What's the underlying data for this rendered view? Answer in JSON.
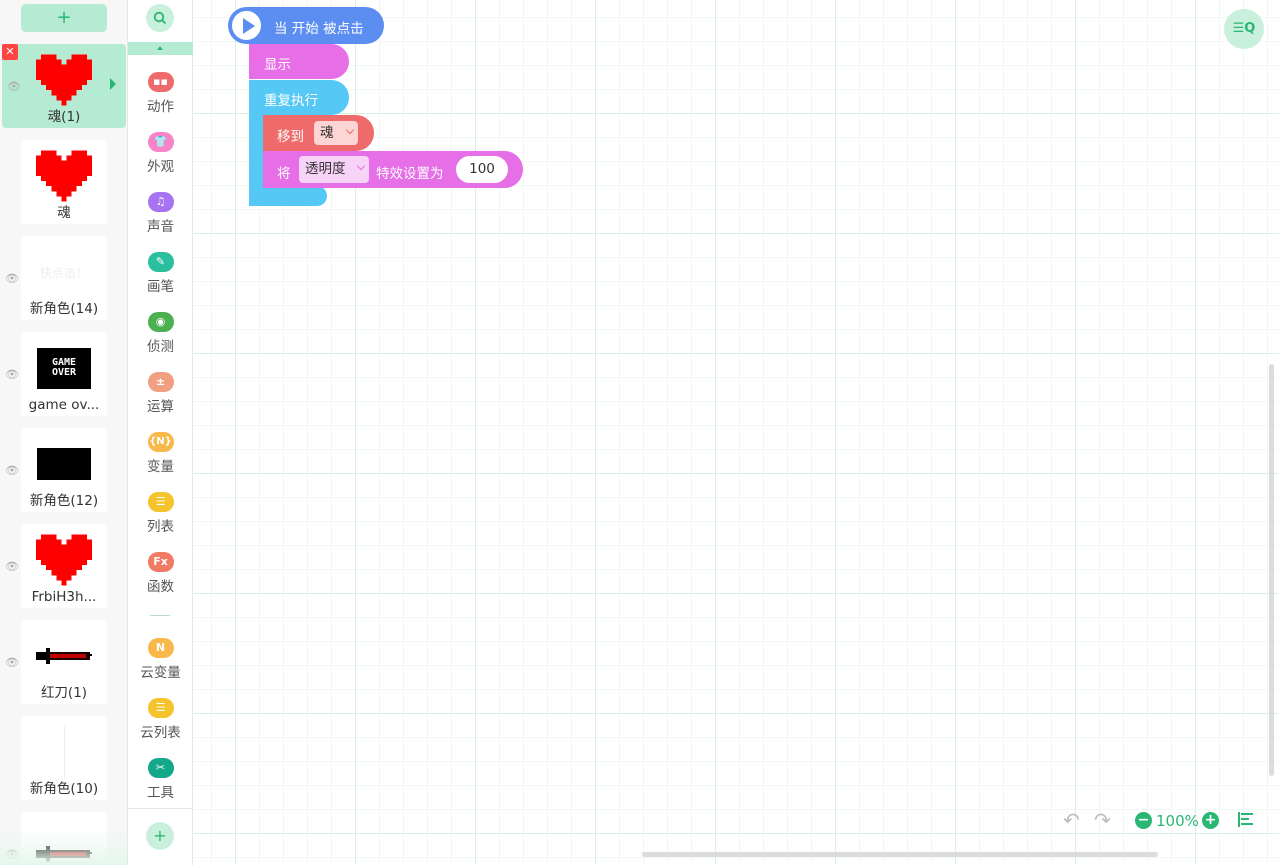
{
  "sprite_panel": {
    "add_label": "+",
    "sprites": [
      {
        "name": "魂(1)",
        "thumb": "red-heart",
        "selected": true
      },
      {
        "name": "魂",
        "thumb": "red-heart"
      },
      {
        "name": "新角色(14)",
        "thumb": "faint-text",
        "thumb_text": "快点击！"
      },
      {
        "name": "game ov...",
        "thumb": "game-over",
        "thumb_text": "GAME OVER"
      },
      {
        "name": "新角色(12)",
        "thumb": "black-rect"
      },
      {
        "name": "FrbiH3h...",
        "thumb": "red-heart"
      },
      {
        "name": "红刀(1)",
        "thumb": "red-knife"
      },
      {
        "name": "新角色(10)",
        "thumb": "thin-line"
      },
      {
        "name": "",
        "thumb": "red-knife"
      }
    ]
  },
  "palette": {
    "search_icon": "search-icon",
    "add_label": "+",
    "categories": [
      {
        "label": "动作",
        "icon": "motion-icon",
        "glyph": "▪▪",
        "color": "#ef6a6a"
      },
      {
        "label": "外观",
        "icon": "shirt-icon",
        "glyph": "👕",
        "color": "#f783c8"
      },
      {
        "label": "声音",
        "icon": "music-note-icon",
        "glyph": "♫",
        "color": "#a873f0"
      },
      {
        "label": "画笔",
        "icon": "pen-icon",
        "glyph": "✎",
        "color": "#2bbf9e"
      },
      {
        "label": "侦测",
        "icon": "sensing-icon",
        "glyph": "◉",
        "color": "#4caf50"
      },
      {
        "label": "运算",
        "icon": "operator-icon",
        "glyph": "±",
        "color": "#f0a080"
      },
      {
        "label": "变量",
        "icon": "variable-icon",
        "glyph": "{N}",
        "color": "#f8b84a"
      },
      {
        "label": "列表",
        "icon": "list-icon",
        "glyph": "☰",
        "color": "#f5c32c"
      },
      {
        "label": "函数",
        "icon": "function-icon",
        "glyph": "Fx",
        "color": "#f07a63"
      },
      {
        "label": "云变量",
        "icon": "cloud-variable-icon",
        "glyph": "N",
        "color": "#f8b84a"
      },
      {
        "label": "云列表",
        "icon": "cloud-list-icon",
        "glyph": "☰",
        "color": "#f5c32c"
      },
      {
        "label": "工具",
        "icon": "tools-icon",
        "glyph": "✂",
        "color": "#14a88a"
      }
    ]
  },
  "blocks": {
    "hat": "当 开始 被点击",
    "show": "显示",
    "repeat": "重复执行",
    "move_to": "移到",
    "move_target": "魂",
    "set_prefix": "将",
    "effect_name": "透明度",
    "set_suffix": "特效设置为",
    "effect_value": "100"
  },
  "toolbar": {
    "zoom_out": "−",
    "zoom": "100%",
    "zoom_in": "+",
    "undo": "↶",
    "redo": "↷",
    "search_fab": "☰Q"
  },
  "colors": {
    "accent": "#2bb673",
    "event": "#5c8ef2",
    "looks": "#e66ee6",
    "control": "#55c8f5",
    "motion": "#ef6a6a"
  }
}
